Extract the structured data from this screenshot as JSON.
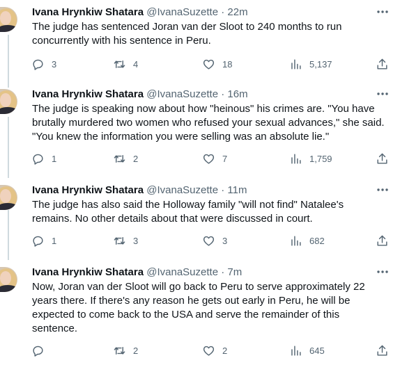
{
  "tweets": [
    {
      "name": "Ivana Hrynkiw Shatara",
      "handle": "@IvanaSuzette",
      "time": "22m",
      "text": "The judge has sentenced Joran van der Sloot to 240 months to run concurrently with his sentence in Peru.",
      "replies": "3",
      "retweets": "4",
      "likes": "18",
      "views": "5,137"
    },
    {
      "name": "Ivana Hrynkiw Shatara",
      "handle": "@IvanaSuzette",
      "time": "16m",
      "text": "The judge is speaking now about how \"heinous\" his crimes are. \"You have brutally murdered two women who refused your sexual advances,\" she said. \"You knew the information you were selling was an absolute lie.\"",
      "replies": "1",
      "retweets": "2",
      "likes": "7",
      "views": "1,759"
    },
    {
      "name": "Ivana Hrynkiw Shatara",
      "handle": "@IvanaSuzette",
      "time": "11m",
      "text": "The judge has also said the Holloway family \"will not find\" Natalee's remains. No other details about that were discussed in court.",
      "replies": "1",
      "retweets": "3",
      "likes": "3",
      "views": "682"
    },
    {
      "name": "Ivana Hrynkiw Shatara",
      "handle": "@IvanaSuzette",
      "time": "7m",
      "text": "Now, Joran van der Sloot will go back to Peru to serve approximately 22 years there. If there's any reason he gets out early in Peru, he will be expected to come back to the USA and serve the remainder of this sentence.",
      "replies": "",
      "retweets": "2",
      "likes": "2",
      "views": "645"
    }
  ],
  "separator": " · ",
  "icons": {
    "more": "more-horizontal-icon",
    "reply": "reply-icon",
    "retweet": "retweet-icon",
    "like": "heart-icon",
    "views": "views-chart-icon",
    "share": "share-icon"
  },
  "colors": {
    "text": "#0f1419",
    "secondary": "#536471",
    "thread_line": "#cfd9de"
  }
}
